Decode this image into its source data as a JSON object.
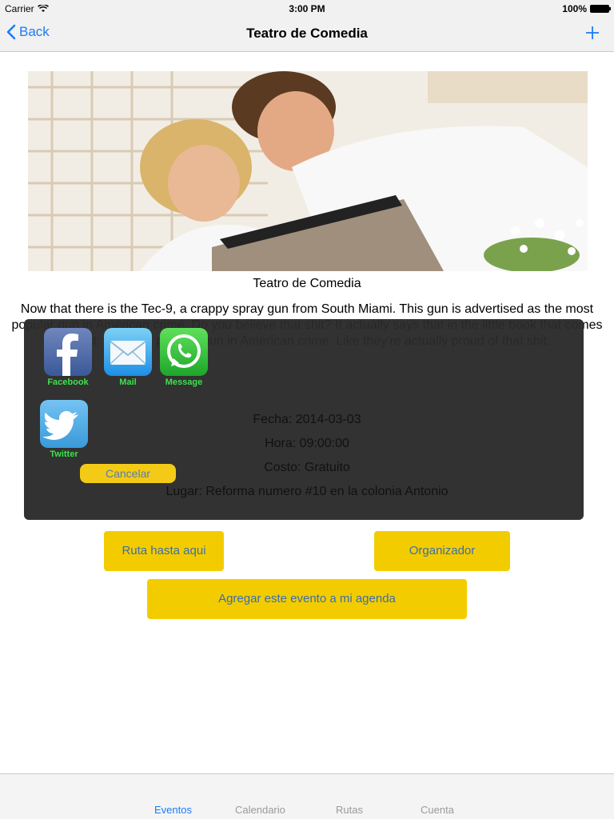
{
  "status_bar": {
    "carrier": "Carrier",
    "time": "3:00 PM",
    "battery": "100%"
  },
  "nav": {
    "back_label": "Back",
    "title": "Teatro de Comedia",
    "add_icon": "plus-icon"
  },
  "event": {
    "image_caption": "Teatro de Comedia",
    "description": "Now that there is the Tec-9, a crappy spray gun from South Miami. This gun is advertised as the most popular gun in American crime. Do you believe that shit? It actually says that in the little book that comes with it: the most popular gun in American crime. Like they're actually proud of that shit.",
    "fecha": "Fecha: 2014-03-03",
    "hora": "Hora: 09:00:00",
    "costo": "Costo: Gratuito",
    "lugar": "Lugar: Reforma numero #10 en la colonia Antonio"
  },
  "share_sheet": {
    "items": [
      {
        "label": "Facebook",
        "icon": "facebook-icon"
      },
      {
        "label": "Mail",
        "icon": "mail-icon"
      },
      {
        "label": "Message",
        "icon": "whatsapp-icon"
      },
      {
        "label": "Twitter",
        "icon": "twitter-icon"
      }
    ],
    "cancel_label": "Cancelar"
  },
  "actions": {
    "route_label": "Ruta hasta aqui",
    "organizer_label": "Organizador",
    "agenda_label": "Agregar este evento a mi agenda"
  },
  "tabs": [
    {
      "label": "Eventos",
      "active": true
    },
    {
      "label": "Calendario",
      "active": false
    },
    {
      "label": "Rutas",
      "active": false
    },
    {
      "label": "Cuenta",
      "active": false
    }
  ],
  "colors": {
    "accent": "#1a7cf5",
    "button_yellow": "#f3cc00",
    "share_label_green": "#3fe14d",
    "overlay": "#2a2a2a"
  }
}
